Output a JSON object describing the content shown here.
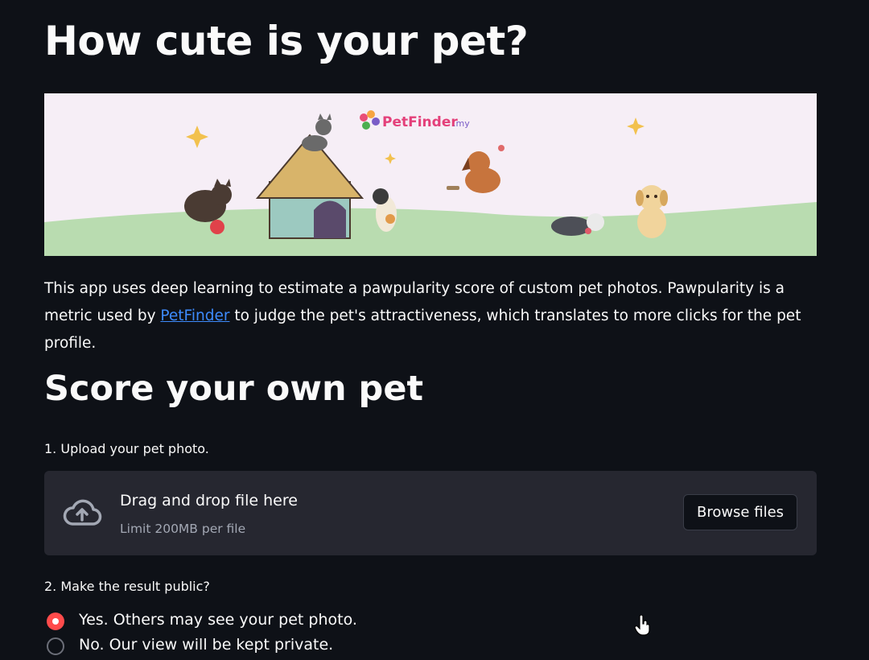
{
  "page": {
    "title": "How cute is your pet?"
  },
  "banner": {
    "logo_text": "PetFinder",
    "logo_suffix": ".my"
  },
  "intro": {
    "text_before": "This app uses deep learning to estimate a pawpularity score of custom pet photos. Pawpularity is a metric used by ",
    "link": "PetFinder",
    "text_after": " to judge the pet's attractiveness, which translates to more clicks for the pet profile."
  },
  "section": {
    "heading": "Score your own pet"
  },
  "upload": {
    "label": "1. Upload your pet photo.",
    "drop_text": "Drag and drop file here",
    "limit_text": "Limit 200MB per file",
    "browse_label": "Browse files",
    "icon": "cloud-upload-icon"
  },
  "public": {
    "label": "2. Make the result public?",
    "options": [
      {
        "label": "Yes. Others may see your pet photo.",
        "selected": true
      },
      {
        "label": "No. Our view will be kept private.",
        "selected": false
      }
    ]
  },
  "colors": {
    "background": "#0e1117",
    "accent": "#ff4b4b",
    "link": "#3d8bfd",
    "uploader_bg": "#262730"
  }
}
